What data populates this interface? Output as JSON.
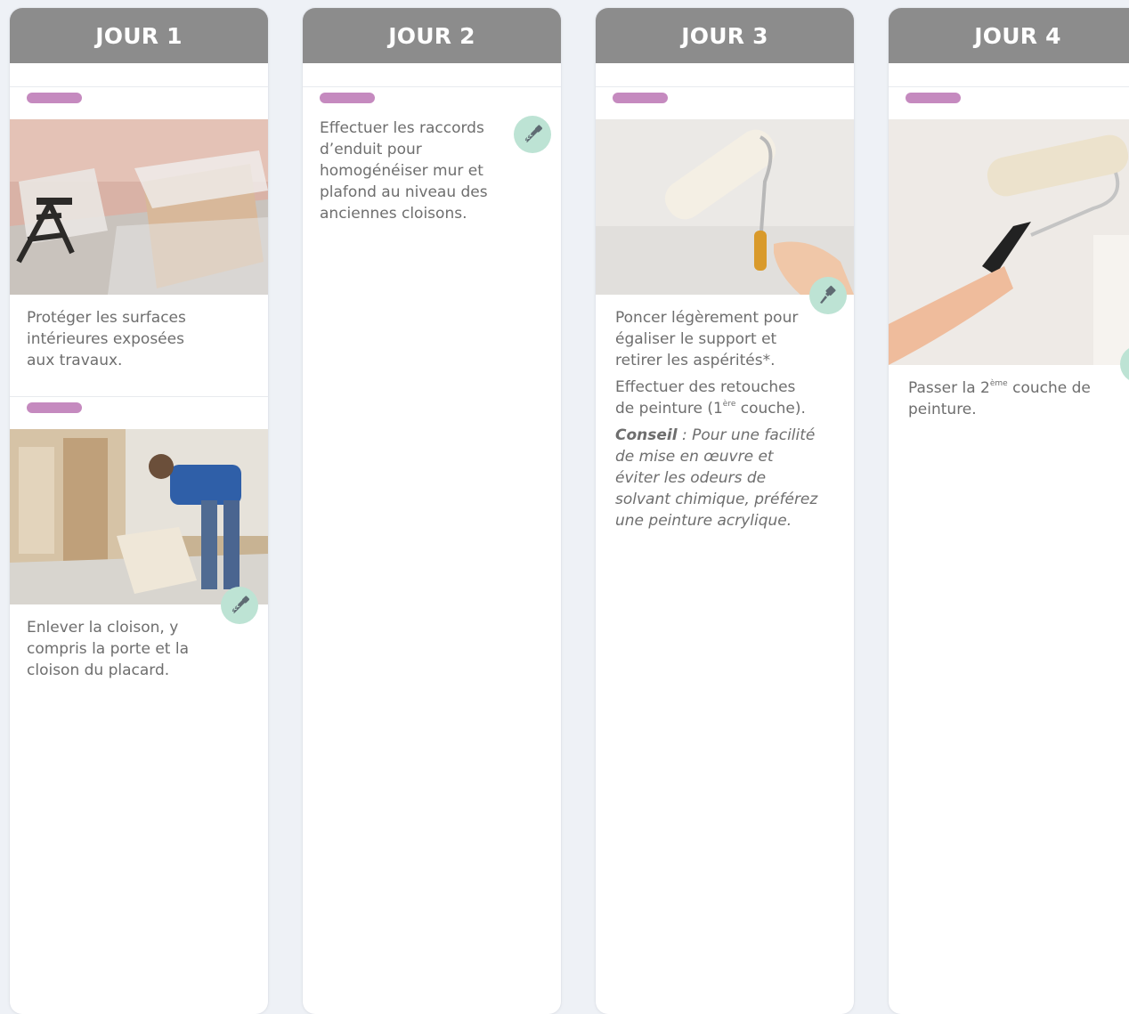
{
  "days": [
    {
      "title": "JOUR 1",
      "steps": [
        {
          "tool_icon": "none",
          "image": "room-protected-with-plastic-sheets",
          "text": "Protéger les surfaces intérieures exposées aux travaux."
        },
        {
          "tool_icon": "saw-icon",
          "image": "worker-removing-partition",
          "text": "Enlever la cloison, y compris la porte et la cloison du placard."
        }
      ]
    },
    {
      "title": "JOUR 2",
      "steps": [
        {
          "tool_icon": "saw-icon",
          "text": "Effectuer les raccords d’enduit pour homogénéiser mur et plafond au niveau des anciennes cloisons."
        }
      ]
    },
    {
      "title": "JOUR 3",
      "steps": [
        {
          "tool_icon": "paintbrush-icon",
          "image": "paint-roller-on-wall",
          "text_1": "Poncer légèrement pour égaliser le support et retirer les aspérités*.",
          "text_2_before": "Effectuer des retouches de peinture (1",
          "text_2_sup": "ère",
          "text_2_after": " couche).",
          "advice_label": "Conseil",
          "advice_text": " : Pour une facilité de mise en œuvre et éviter les odeurs de solvant chimique, préférez une peinture acrylique."
        }
      ]
    },
    {
      "title": "JOUR 4",
      "steps": [
        {
          "tool_icon": "paintbrush-icon",
          "image": "hand-with-paint-roller",
          "text_before": "Passer la 2",
          "text_sup": "ème",
          "text_after": " couche de peinture."
        }
      ]
    }
  ],
  "colors": {
    "header": "#8c8c8c",
    "tag": "#c58abf",
    "tool_bg": "#bde3d4",
    "text": "#6e6e6e"
  }
}
